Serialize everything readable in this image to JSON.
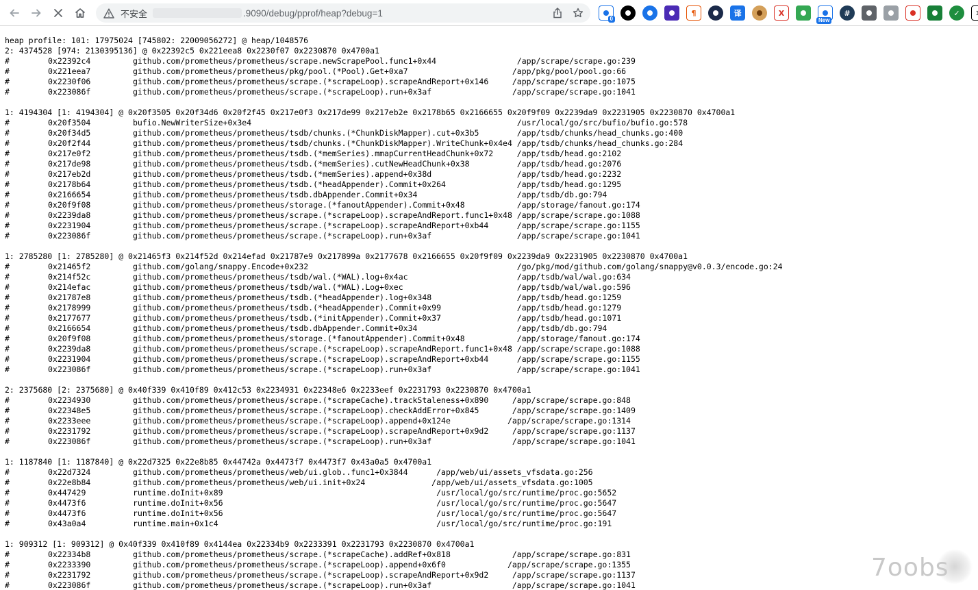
{
  "browser": {
    "insecure_label": "不安全",
    "url": ".9090/debug/pprof/heap?debug=1",
    "extensions": [
      {
        "icon": "sync-icon",
        "badge": "0",
        "bg": "#ffffff",
        "fg": "#1a73e8"
      },
      {
        "icon": "circle-extension-icon",
        "bg": "#000000",
        "fg": "#ffffff"
      },
      {
        "icon": "goggles-extension-icon",
        "bg": "#1a73e8",
        "fg": "#ffffff"
      },
      {
        "icon": "cube-extension-icon",
        "bg": "#4a2bb5",
        "fg": "#ffffff"
      },
      {
        "icon": "pilcrow-extension-icon",
        "glyph": "¶",
        "bg": "#ffffff",
        "fg": "#e65100"
      },
      {
        "icon": "github-extension-icon",
        "bg": "#1b2a4a",
        "fg": "#ffffff"
      },
      {
        "icon": "translate-extension-icon",
        "glyph": "译",
        "bg": "#1a73e8",
        "fg": "#ffffff"
      },
      {
        "icon": "cookie-extension-icon",
        "bg": "#d4a05a",
        "fg": "#6d3b0a"
      },
      {
        "icon": "x-extension-icon",
        "glyph": "X",
        "bg": "#ffffff",
        "fg": "#d93025"
      },
      {
        "icon": "chat-extension-icon",
        "bg": "#34a853",
        "fg": "#ffffff"
      },
      {
        "icon": "window-extension-icon",
        "badge": "New",
        "bg": "#ffffff",
        "fg": "#1a73e8"
      },
      {
        "icon": "hash-extension-icon",
        "glyph": "#",
        "bg": "#1f3b57",
        "fg": "#ffffff"
      },
      {
        "icon": "camera-extension-icon",
        "bg": "#5f6368",
        "fg": "#ffffff"
      },
      {
        "icon": "wallet-extension-icon",
        "bg": "#9aa0a6",
        "fg": "#ffffff"
      },
      {
        "icon": "presentation-extension-icon",
        "bg": "#ffffff",
        "fg": "#d93025"
      },
      {
        "icon": "spreadsheet-extension-icon",
        "bg": "#188038",
        "fg": "#ffffff"
      },
      {
        "icon": "check-extension-icon",
        "glyph": "✓",
        "bg": "#1e8e3e",
        "fg": "#ffffff"
      },
      {
        "icon": "puzzle-extension-icon",
        "glyph": "✕",
        "bg": "#ffffff",
        "fg": "#000000"
      }
    ]
  },
  "profile_lines": [
    [
      "heap profile: 101: 17975024 [745802: 22009056272] @ heap/1048576"
    ],
    [
      "2: 4374528 [974: 2130395136] @ 0x22392c5 0x221eea8 0x2230f07 0x2230870 0x4700a1"
    ],
    [
      "#",
      "0x22392c4",
      "github.com/prometheus/prometheus/scrape.newScrapePool.func1+0x44                 /app/scrape/scrape.go:239"
    ],
    [
      "#",
      "0x221eea7",
      "github.com/prometheus/prometheus/pkg/pool.(*Pool).Get+0xa7                      /app/pkg/pool/pool.go:66"
    ],
    [
      "#",
      "0x2230f06",
      "github.com/prometheus/prometheus/scrape.(*scrapeLoop).scrapeAndReport+0x146     /app/scrape/scrape.go:1075"
    ],
    [
      "#",
      "0x223086f",
      "github.com/prometheus/prometheus/scrape.(*scrapeLoop).run+0x3af                 /app/scrape/scrape.go:1041"
    ],
    [],
    [
      "1: 4194304 [1: 4194304] @ 0x20f3505 0x20f34d6 0x20f2f45 0x217e0f3 0x217de99 0x217eb2e 0x2178b65 0x2166655 0x20f9f09 0x2239da9 0x2231905 0x2230870 0x4700a1"
    ],
    [
      "#",
      "0x20f3504",
      "bufio.NewWriterSize+0x3e4                                                        /usr/local/go/src/bufio/bufio.go:578"
    ],
    [
      "#",
      "0x20f34d5",
      "github.com/prometheus/prometheus/tsdb/chunks.(*ChunkDiskMapper).cut+0x3b5        /app/tsdb/chunks/head_chunks.go:400"
    ],
    [
      "#",
      "0x20f2f44",
      "github.com/prometheus/prometheus/tsdb/chunks.(*ChunkDiskMapper).WriteChunk+0x4e4 /app/tsdb/chunks/head_chunks.go:284"
    ],
    [
      "#",
      "0x217e0f2",
      "github.com/prometheus/prometheus/tsdb.(*memSeries).mmapCurrentHeadChunk+0x72     /app/tsdb/head.go:2102"
    ],
    [
      "#",
      "0x217de98",
      "github.com/prometheus/prometheus/tsdb.(*memSeries).cutNewHeadChunk+0x38          /app/tsdb/head.go:2076"
    ],
    [
      "#",
      "0x217eb2d",
      "github.com/prometheus/prometheus/tsdb.(*memSeries).append+0x38d                  /app/tsdb/head.go:2232"
    ],
    [
      "#",
      "0x2178b64",
      "github.com/prometheus/prometheus/tsdb.(*headAppender).Commit+0x264               /app/tsdb/head.go:1295"
    ],
    [
      "#",
      "0x2166654",
      "github.com/prometheus/prometheus/tsdb.dbAppender.Commit+0x34                     /app/tsdb/db.go:794"
    ],
    [
      "#",
      "0x20f9f08",
      "github.com/prometheus/prometheus/storage.(*fanoutAppender).Commit+0x48           /app/storage/fanout.go:174"
    ],
    [
      "#",
      "0x2239da8",
      "github.com/prometheus/prometheus/scrape.(*scrapeLoop).scrapeAndReport.func1+0x48 /app/scrape/scrape.go:1088"
    ],
    [
      "#",
      "0x2231904",
      "github.com/prometheus/prometheus/scrape.(*scrapeLoop).scrapeAndReport+0xb44      /app/scrape/scrape.go:1155"
    ],
    [
      "#",
      "0x223086f",
      "github.com/prometheus/prometheus/scrape.(*scrapeLoop).run+0x3af                  /app/scrape/scrape.go:1041"
    ],
    [],
    [
      "1: 2785280 [1: 2785280] @ 0x21465f3 0x214f52d 0x214efad 0x21787e9 0x217899a 0x2177678 0x2166655 0x20f9f09 0x2239da9 0x2231905 0x2230870 0x4700a1"
    ],
    [
      "#",
      "0x21465f2",
      "github.com/golang/snappy.Encode+0x232                                            /go/pkg/mod/github.com/golang/snappy@v0.0.3/encode.go:24"
    ],
    [
      "#",
      "0x214f52c",
      "github.com/prometheus/prometheus/tsdb/wal.(*WAL).log+0x4ac                       /app/tsdb/wal/wal.go:634"
    ],
    [
      "#",
      "0x214efac",
      "github.com/prometheus/prometheus/tsdb/wal.(*WAL).Log+0xec                        /app/tsdb/wal/wal.go:596"
    ],
    [
      "#",
      "0x21787e8",
      "github.com/prometheus/prometheus/tsdb.(*headAppender).log+0x348                  /app/tsdb/head.go:1259"
    ],
    [
      "#",
      "0x2178999",
      "github.com/prometheus/prometheus/tsdb.(*headAppender).Commit+0x99                /app/tsdb/head.go:1279"
    ],
    [
      "#",
      "0x2177677",
      "github.com/prometheus/prometheus/tsdb.(*initAppender).Commit+0x37                /app/tsdb/head.go:1071"
    ],
    [
      "#",
      "0x2166654",
      "github.com/prometheus/prometheus/tsdb.dbAppender.Commit+0x34                     /app/tsdb/db.go:794"
    ],
    [
      "#",
      "0x20f9f08",
      "github.com/prometheus/prometheus/storage.(*fanoutAppender).Commit+0x48           /app/storage/fanout.go:174"
    ],
    [
      "#",
      "0x2239da8",
      "github.com/prometheus/prometheus/scrape.(*scrapeLoop).scrapeAndReport.func1+0x48 /app/scrape/scrape.go:1088"
    ],
    [
      "#",
      "0x2231904",
      "github.com/prometheus/prometheus/scrape.(*scrapeLoop).scrapeAndReport+0xb44      /app/scrape/scrape.go:1155"
    ],
    [
      "#",
      "0x223086f",
      "github.com/prometheus/prometheus/scrape.(*scrapeLoop).run+0x3af                  /app/scrape/scrape.go:1041"
    ],
    [],
    [
      "2: 2375680 [2: 2375680] @ 0x40f339 0x410f89 0x412c53 0x2234931 0x22348e6 0x2233eef 0x2231793 0x2230870 0x4700a1"
    ],
    [
      "#",
      "0x2234930",
      "github.com/prometheus/prometheus/scrape.(*scrapeCache).trackStaleness+0x890     /app/scrape/scrape.go:848"
    ],
    [
      "#",
      "0x22348e5",
      "github.com/prometheus/prometheus/scrape.(*scrapeLoop).checkAddError+0x845       /app/scrape/scrape.go:1409"
    ],
    [
      "#",
      "0x2233eee",
      "github.com/prometheus/prometheus/scrape.(*scrapeLoop).append+0x124e            /app/scrape/scrape.go:1314"
    ],
    [
      "#",
      "0x2231792",
      "github.com/prometheus/prometheus/scrape.(*scrapeLoop).scrapeAndReport+0x9d2     /app/scrape/scrape.go:1137"
    ],
    [
      "#",
      "0x223086f",
      "github.com/prometheus/prometheus/scrape.(*scrapeLoop).run+0x3af                 /app/scrape/scrape.go:1041"
    ],
    [],
    [
      "1: 1187840 [1: 1187840] @ 0x22d7325 0x22e8b85 0x44742a 0x4473f7 0x4473f7 0x43a0a5 0x4700a1"
    ],
    [
      "#",
      "0x22d7324",
      "github.com/prometheus/prometheus/web/ui.glob..func1+0x3844      /app/web/ui/assets_vfsdata.go:256"
    ],
    [
      "#",
      "0x22e8b84",
      "github.com/prometheus/prometheus/web/ui.init+0x24              /app/web/ui/assets_vfsdata.go:1005"
    ],
    [
      "#",
      "0x447429",
      "runtime.doInit+0x89                                             /usr/local/go/src/runtime/proc.go:5652"
    ],
    [
      "#",
      "0x4473f6",
      "runtime.doInit+0x56                                             /usr/local/go/src/runtime/proc.go:5647"
    ],
    [
      "#",
      "0x4473f6",
      "runtime.doInit+0x56                                             /usr/local/go/src/runtime/proc.go:5647"
    ],
    [
      "#",
      "0x43a0a4",
      "runtime.main+0x1c4                                              /usr/local/go/src/runtime/proc.go:191"
    ],
    [],
    [
      "1: 909312 [1: 909312] @ 0x40f339 0x410f89 0x4144ea 0x22334b9 0x2233391 0x2231793 0x2230870 0x4700a1"
    ],
    [
      "#",
      "0x22334b8",
      "github.com/prometheus/prometheus/scrape.(*scrapeCache).addRef+0x818             /app/scrape/scrape.go:831"
    ],
    [
      "#",
      "0x2233390",
      "github.com/prometheus/prometheus/scrape.(*scrapeLoop).append+0x6f0             /app/scrape/scrape.go:1355"
    ],
    [
      "#",
      "0x2231792",
      "github.com/prometheus/prometheus/scrape.(*scrapeLoop).scrapeAndReport+0x9d2     /app/scrape/scrape.go:1137"
    ],
    [
      "#",
      "0x223086f",
      "github.com/prometheus/prometheus/scrape.(*scrapeLoop).run+0x3af                 /app/scrape/scrape.go:1041"
    ]
  ],
  "watermark": "7oobs"
}
